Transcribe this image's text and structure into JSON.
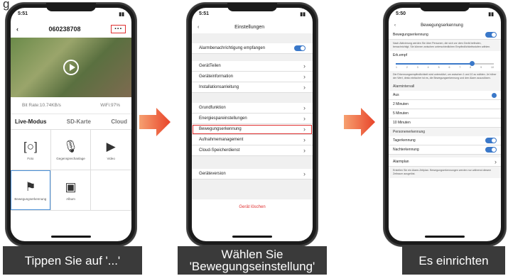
{
  "top_text": "g",
  "captions": [
    "Tippen Sie auf '...'",
    "Wählen Sie 'Bewegungseinstellung'",
    "Es einrichten"
  ],
  "phone1": {
    "time": "5:51",
    "title": "060238708",
    "more_label": "···",
    "bitrate": "Bit Rate:10.74KB/s",
    "wifi": "WiFi:97%",
    "tabs": [
      "Live-Modus",
      "SD-Karte",
      "Cloud"
    ],
    "grid": [
      "Foto",
      "Gegensprechanlage",
      "Video",
      "Bewegungserkennung",
      "Album"
    ]
  },
  "phone2": {
    "time": "5:51",
    "title": "Einstellungen",
    "alarm_row": "Alarmbenachrichtigung empfangen",
    "group1": [
      "GerätTeilen",
      "Geräteinformation",
      "Installationsanleitung"
    ],
    "group2": [
      "Grundfunktion",
      "Energiespareinstellungen",
      "Bewegungserkennung",
      "Aufnahmemanagement",
      "Cloud-Speicherdienst"
    ],
    "version": "Geräteversion",
    "delete": "Gerät löschen"
  },
  "phone3": {
    "time": "5:50",
    "title": "Bewegungserkennung",
    "toggle_label": "Bewegungserkennung",
    "desc1": "Nach Aktivierung werden Sie über Personen, die sich vor dem Gerät befinden, benachrichtigt. Sie können zwischen unterschiedlichen Empfindlichkeitsstufen wählen.",
    "sens_label": "Erk.empf",
    "ticks": [
      "1",
      "2",
      "3",
      "4",
      "5",
      "6",
      "7",
      "8",
      "9",
      "10"
    ],
    "sensitivity_value": 8,
    "desc2": "Die Erkennungsempfindlichkeit wird unterstützt, um zwischen 1 und 10 zu wählen. Je höher der Wert, desto einfacher ist es, die Bewegungserkennung und den Alarm auszulösen.",
    "interval_title": "Alarmintervall",
    "intervals": [
      "Aus",
      "2 Minuten",
      "5 Minuten",
      "10 Minuten"
    ],
    "person_title": "Personenerkennung",
    "day": "Tagerkennung",
    "night": "Nachterkennung",
    "plan": "Alarmplan",
    "plan_desc": "Erstellen Sie ein Alarm-Zeitplan. Bewegungserkennungen werden nur während diesem Zeitraum ausgelöst."
  }
}
